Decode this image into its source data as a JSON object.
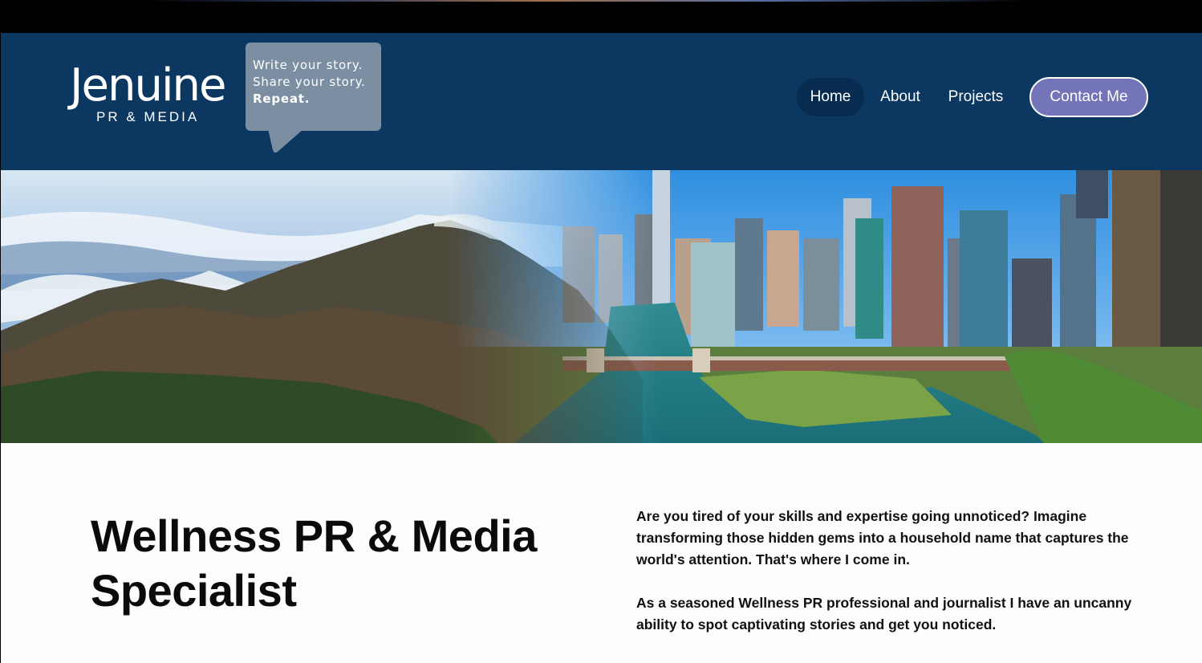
{
  "brand": {
    "name": "Jenuine",
    "subtitle": "PR & MEDIA",
    "tagline": [
      "Write your story.",
      "Share your story.",
      "Repeat."
    ]
  },
  "nav": {
    "items": [
      "Home",
      "About",
      "Projects"
    ],
    "active": "Home",
    "cta": "Contact Me"
  },
  "colors": {
    "header_bg": "#0b3760",
    "active_pill": "#082c4f",
    "cta_bg": "#7474b8",
    "bubble_bg": "#7b8ea2"
  },
  "hero": {
    "image": "mountain landscape blending into river city skyline"
  },
  "main": {
    "title": "Wellness PR & Media Specialist",
    "paragraphs": [
      "Are you tired of your skills and expertise going unnoticed? Imagine transforming those hidden gems into a household name that captures the world's attention. That's where I come in.",
      "As a seasoned Wellness PR professional and journalist I have an uncanny ability to spot captivating stories and get you noticed."
    ]
  }
}
